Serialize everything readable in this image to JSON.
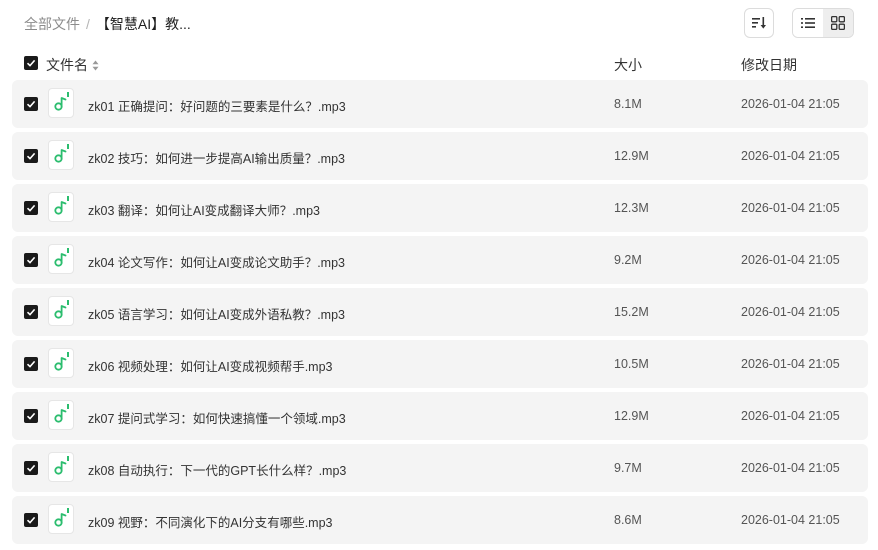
{
  "breadcrumb": {
    "root": "全部文件",
    "separator": "/",
    "current": "【智慧AI】教..."
  },
  "toolbar": {
    "sort_icon": "sort-icon",
    "list_view_icon": "list-view-icon",
    "grid_view_icon": "grid-view-icon",
    "active_view": "list"
  },
  "columns": {
    "name": "文件名",
    "size": "大小",
    "date": "修改日期"
  },
  "colors": {
    "row_bg": "#f4f4f4",
    "checkbox": "#1a1a1a",
    "audio_icon_green": "#2bbd6e"
  },
  "files": [
    {
      "name": "zk01 正确提问：好问题的三要素是什么？.mp3",
      "size": "8.1M",
      "date": "2026-01-04 21:05",
      "checked": true,
      "icon": "audio-file-icon"
    },
    {
      "name": "zk02 技巧：如何进一步提高AI输出质量？.mp3",
      "size": "12.9M",
      "date": "2026-01-04 21:05",
      "checked": true,
      "icon": "audio-file-icon"
    },
    {
      "name": "zk03 翻译：如何让AI变成翻译大师？.mp3",
      "size": "12.3M",
      "date": "2026-01-04 21:05",
      "checked": true,
      "icon": "audio-file-icon"
    },
    {
      "name": "zk04 论文写作：如何让AI变成论文助手？.mp3",
      "size": "9.2M",
      "date": "2026-01-04 21:05",
      "checked": true,
      "icon": "audio-file-icon"
    },
    {
      "name": "zk05 语言学习：如何让AI变成外语私教？.mp3",
      "size": "15.2M",
      "date": "2026-01-04 21:05",
      "checked": true,
      "icon": "audio-file-icon"
    },
    {
      "name": "zk06 视频处理：如何让AI变成视频帮手.mp3",
      "size": "10.5M",
      "date": "2026-01-04 21:05",
      "checked": true,
      "icon": "audio-file-icon"
    },
    {
      "name": "zk07 提问式学习：如何快速搞懂一个领域.mp3",
      "size": "12.9M",
      "date": "2026-01-04 21:05",
      "checked": true,
      "icon": "audio-file-icon"
    },
    {
      "name": "zk08 自动执行：下一代的GPT长什么样？.mp3",
      "size": "9.7M",
      "date": "2026-01-04 21:05",
      "checked": true,
      "icon": "audio-file-icon"
    },
    {
      "name": "zk09 视野：不同演化下的AI分支有哪些.mp3",
      "size": "8.6M",
      "date": "2026-01-04 21:05",
      "checked": true,
      "icon": "audio-file-icon"
    }
  ]
}
